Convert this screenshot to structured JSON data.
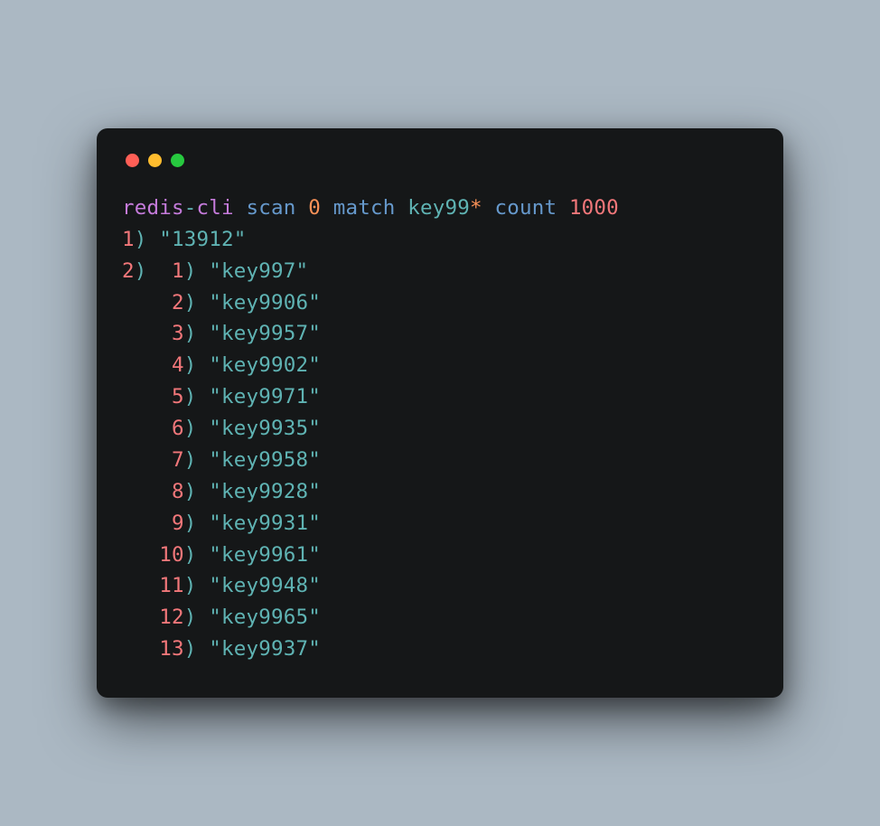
{
  "command": {
    "tool_pre": "redis",
    "dash": "-",
    "tool_post": "cli",
    "sub1": "scan",
    "arg_zero": "0",
    "sub2": "match",
    "pattern_text": "key99",
    "pattern_star": "*",
    "sub3": "count",
    "count_num": "1000"
  },
  "output": {
    "top": [
      {
        "idx": "1",
        "value": "13912"
      }
    ],
    "nested_idx": "2",
    "items": [
      {
        "idx": "1",
        "value": "key997"
      },
      {
        "idx": "2",
        "value": "key9906"
      },
      {
        "idx": "3",
        "value": "key9957"
      },
      {
        "idx": "4",
        "value": "key9902"
      },
      {
        "idx": "5",
        "value": "key9971"
      },
      {
        "idx": "6",
        "value": "key9935"
      },
      {
        "idx": "7",
        "value": "key9958"
      },
      {
        "idx": "8",
        "value": "key9928"
      },
      {
        "idx": "9",
        "value": "key9931"
      },
      {
        "idx": "10",
        "value": "key9961"
      },
      {
        "idx": "11",
        "value": "key9948"
      },
      {
        "idx": "12",
        "value": "key9965"
      },
      {
        "idx": "13",
        "value": "key9937"
      }
    ]
  }
}
